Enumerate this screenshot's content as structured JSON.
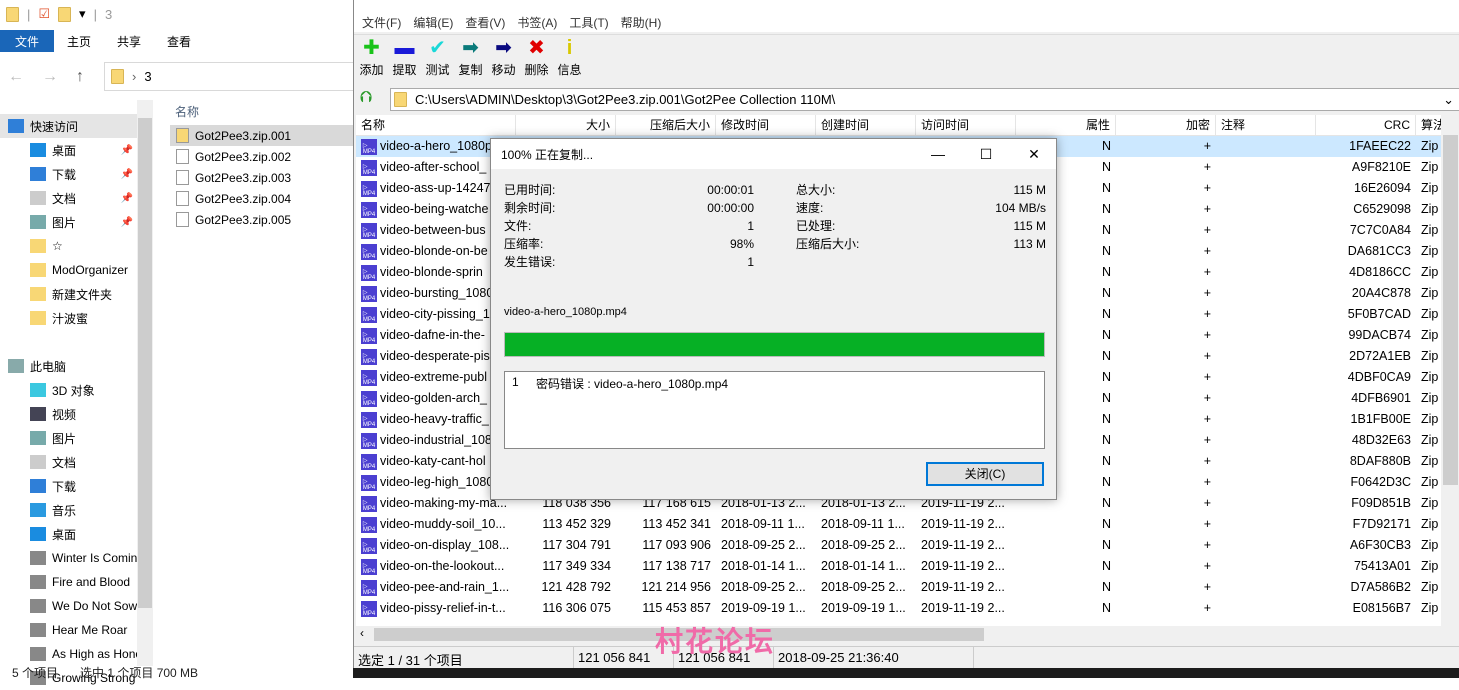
{
  "explorer": {
    "path_current": "3",
    "ribbon_tabs": [
      "文件",
      "主页",
      "共享",
      "查看"
    ],
    "address": "3",
    "tree": [
      {
        "label": "快速访问",
        "icon": "star-icon",
        "sel": true,
        "indent": 0
      },
      {
        "label": "桌面",
        "icon": "desktop-icon",
        "pin": true,
        "indent": 1
      },
      {
        "label": "下载",
        "icon": "download-icon",
        "pin": true,
        "indent": 1
      },
      {
        "label": "文档",
        "icon": "document-icon",
        "pin": true,
        "indent": 1
      },
      {
        "label": "图片",
        "icon": "pictures-icon",
        "pin": true,
        "indent": 1
      },
      {
        "label": "☆",
        "icon": "folder-icon",
        "indent": 1
      },
      {
        "label": "ModOrganizer",
        "icon": "folder-icon",
        "indent": 1
      },
      {
        "label": "新建文件夹",
        "icon": "folder-icon",
        "indent": 1
      },
      {
        "label": "汁波蜜",
        "icon": "folder-icon",
        "indent": 1
      },
      {
        "label": "",
        "icon": "",
        "indent": 0
      },
      {
        "label": "此电脑",
        "icon": "computer-icon",
        "indent": 0
      },
      {
        "label": "3D 对象",
        "icon": "3d-objects-icon",
        "indent": 1
      },
      {
        "label": "视频",
        "icon": "video-icon",
        "indent": 1
      },
      {
        "label": "图片",
        "icon": "pictures-icon",
        "indent": 1
      },
      {
        "label": "文档",
        "icon": "document-icon",
        "indent": 1
      },
      {
        "label": "下载",
        "icon": "download-icon",
        "indent": 1
      },
      {
        "label": "音乐",
        "icon": "music-icon",
        "indent": 1
      },
      {
        "label": "桌面",
        "icon": "desktop-icon",
        "indent": 1
      },
      {
        "label": "Winter Is Coming",
        "icon": "drive-icon",
        "indent": 1
      },
      {
        "label": "Fire and Blood",
        "icon": "drive-icon",
        "indent": 1
      },
      {
        "label": "We Do Not Sow",
        "icon": "drive-icon",
        "indent": 1
      },
      {
        "label": "Hear Me Roar",
        "icon": "drive-icon",
        "indent": 1
      },
      {
        "label": "As High as Honor",
        "icon": "drive-icon",
        "indent": 1
      },
      {
        "label": "Growing Strong",
        "icon": "drive-icon",
        "indent": 1
      }
    ],
    "column_name": "名称",
    "files": [
      "Got2Pee3.zip.001",
      "Got2Pee3.zip.002",
      "Got2Pee3.zip.003",
      "Got2Pee3.zip.004",
      "Got2Pee3.zip.005"
    ],
    "status": {
      "count": "5 个项目",
      "selected": "选中 1 个项目  700 MB"
    }
  },
  "zip": {
    "menu": [
      "文件(F)",
      "编辑(E)",
      "查看(V)",
      "书签(A)",
      "工具(T)",
      "帮助(H)"
    ],
    "toolbar": [
      {
        "label": "添加",
        "icon": "add-icon",
        "glyph": "✚",
        "color": "#19c319"
      },
      {
        "label": "提取",
        "icon": "extract-icon",
        "glyph": "▬",
        "color": "#1a1ad8"
      },
      {
        "label": "测试",
        "icon": "test-icon",
        "glyph": "✔",
        "color": "#1ad8d8"
      },
      {
        "label": "复制",
        "icon": "copy-icon",
        "glyph": "➡",
        "color": "#0a7a7a"
      },
      {
        "label": "移动",
        "icon": "move-icon",
        "glyph": "➡",
        "color": "#0a0a80"
      },
      {
        "label": "删除",
        "icon": "delete-icon",
        "glyph": "✖",
        "color": "#e00000"
      },
      {
        "label": "信息",
        "icon": "info-icon",
        "glyph": "i",
        "color": "#d8c800"
      }
    ],
    "address": "C:\\Users\\ADMIN\\Desktop\\3\\Got2Pee3.zip.001\\Got2Pee Collection 110M\\",
    "columns": [
      "名称",
      "大小",
      "压缩后大小",
      "修改时间",
      "创建时间",
      "访问时间",
      "属性",
      "加密",
      "注释",
      "CRC",
      "算法"
    ],
    "rows": [
      [
        "video-a-hero_1080p.mp4",
        "",
        "",
        "",
        "",
        "",
        "N",
        "+",
        "",
        "1FAEEC22",
        "Zip"
      ],
      [
        "video-after-school_",
        "",
        "",
        "",
        "",
        "",
        "N",
        "+",
        "",
        "A9F8210E",
        "Zip"
      ],
      [
        "video-ass-up-14247",
        "",
        "",
        "",
        "",
        "",
        "N",
        "+",
        "",
        "16E26094",
        "Zip"
      ],
      [
        "video-being-watche",
        "",
        "",
        "",
        "",
        "",
        "N",
        "+",
        "",
        "C6529098",
        "Zip"
      ],
      [
        "video-between-bus",
        "",
        "",
        "",
        "",
        "",
        "N",
        "+",
        "",
        "7C7C0A84",
        "Zip"
      ],
      [
        "video-blonde-on-be",
        "",
        "",
        "",
        "",
        "",
        "N",
        "+",
        "",
        "DA681CC3",
        "Zip"
      ],
      [
        "video-blonde-sprin",
        "",
        "",
        "",
        "",
        "",
        "N",
        "+",
        "",
        "4D8186CC",
        "Zip"
      ],
      [
        "video-bursting_1080",
        "",
        "",
        "",
        "",
        "",
        "N",
        "+",
        "",
        "20A4C878",
        "Zip"
      ],
      [
        "video-city-pissing_1",
        "",
        "",
        "",
        "",
        "",
        "N",
        "+",
        "",
        "5F0B7CAD",
        "Zip"
      ],
      [
        "video-dafne-in-the-",
        "",
        "",
        "",
        "",
        "",
        "N",
        "+",
        "",
        "99DACB74",
        "Zip"
      ],
      [
        "video-desperate-pis",
        "",
        "",
        "",
        "",
        "",
        "N",
        "+",
        "",
        "2D72A1EB",
        "Zip"
      ],
      [
        "video-extreme-publ",
        "",
        "",
        "",
        "",
        "",
        "N",
        "+",
        "",
        "4DBF0CA9",
        "Zip"
      ],
      [
        "video-golden-arch_",
        "",
        "",
        "",
        "",
        "",
        "N",
        "+",
        "",
        "4DFB6901",
        "Zip"
      ],
      [
        "video-heavy-traffic_",
        "",
        "",
        "",
        "",
        "",
        "N",
        "+",
        "",
        "1B1FB00E",
        "Zip"
      ],
      [
        "video-industrial_108",
        "",
        "",
        "",
        "",
        "",
        "N",
        "+",
        "",
        "48D32E63",
        "Zip"
      ],
      [
        "video-katy-cant-hol",
        "",
        "",
        "",
        "",
        "",
        "N",
        "+",
        "",
        "8DAF880B",
        "Zip"
      ],
      [
        "video-leg-high_1080",
        "",
        "",
        "",
        "",
        "",
        "N",
        "+",
        "",
        "F0642D3C",
        "Zip"
      ],
      [
        "video-making-my-ma...",
        "118 038 356",
        "117 168 615",
        "2018-01-13 2...",
        "2018-01-13 2...",
        "2019-11-19 2...",
        "N",
        "+",
        "",
        "F09D851B",
        "Zip"
      ],
      [
        "video-muddy-soil_10...",
        "113 452 329",
        "113 452 341",
        "2018-09-11 1...",
        "2018-09-11 1...",
        "2019-11-19 2...",
        "N",
        "+",
        "",
        "F7D92171",
        "Zip"
      ],
      [
        "video-on-display_108...",
        "117 304 791",
        "117 093 906",
        "2018-09-25 2...",
        "2018-09-25 2...",
        "2019-11-19 2...",
        "N",
        "+",
        "",
        "A6F30CB3",
        "Zip"
      ],
      [
        "video-on-the-lookout...",
        "117 349 334",
        "117 138 717",
        "2018-01-14 1...",
        "2018-01-14 1...",
        "2019-11-19 2...",
        "N",
        "+",
        "",
        "75413A01",
        "Zip"
      ],
      [
        "video-pee-and-rain_1...",
        "121 428 792",
        "121 214 956",
        "2018-09-25 2...",
        "2018-09-25 2...",
        "2019-11-19 2...",
        "N",
        "+",
        "",
        "D7A586B2",
        "Zip"
      ],
      [
        "video-pissy-relief-in-t...",
        "116 306 075",
        "115 453 857",
        "2019-09-19 1...",
        "2019-09-19 1...",
        "2019-11-19 2...",
        "N",
        "+",
        "",
        "E08156B7",
        "Zip"
      ]
    ],
    "status": [
      "选定 1 / 31 个项目",
      "121 056 841",
      "121 056 841",
      "2018-09-25 21:36:40"
    ]
  },
  "dialog": {
    "title": "100% 正在复制...",
    "left_stats": [
      [
        "已用时间:",
        "00:00:01"
      ],
      [
        "剩余时间:",
        "00:00:00"
      ],
      [
        "文件:",
        "1"
      ],
      [
        "压缩率:",
        "98%"
      ],
      [
        "发生错误:",
        "1"
      ]
    ],
    "right_stats": [
      [
        "总大小:",
        "115 M"
      ],
      [
        "速度:",
        "104 MB/s"
      ],
      [
        "已处理:",
        "115 M"
      ],
      [
        "压缩后大小:",
        "113 M"
      ]
    ],
    "current_file": "video-a-hero_1080p.mp4",
    "progress_percent": 100,
    "progress_color": "#06b025",
    "errors": [
      {
        "index": "1",
        "message": "密码错误 : video-a-hero_1080p.mp4"
      }
    ],
    "close_label": "关闭(C)"
  },
  "watermark": {
    "text": "村花论坛",
    "url": "cunhua.win"
  }
}
